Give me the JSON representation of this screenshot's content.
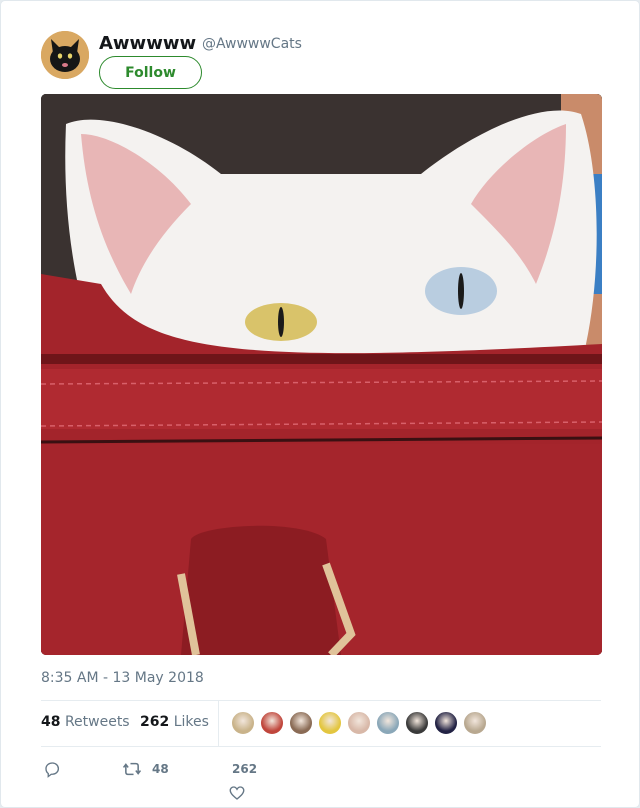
{
  "author": {
    "display_name": "Awwwww",
    "handle": "@AwwwwCats",
    "avatar_icon": "black-cat-avatar"
  },
  "follow_button": {
    "label": "Follow",
    "color": "#2d8a2d"
  },
  "media": {
    "description_icon": "white-cat-in-red-bag-photo"
  },
  "timestamp": "8:35 AM - 13 May 2018",
  "stats": {
    "retweets_count": "48",
    "retweets_label": "Retweets",
    "likes_count": "262",
    "likes_label": "Likes"
  },
  "likers": [
    {
      "color": "#c9b38a"
    },
    {
      "color": "#c0463c"
    },
    {
      "color": "#8a6b55"
    },
    {
      "color": "#e3c640"
    },
    {
      "color": "#d8b8a8"
    },
    {
      "color": "#8aa7b8"
    },
    {
      "color": "#3a3a3a"
    },
    {
      "color": "#222244"
    },
    {
      "color": "#b8a890"
    }
  ],
  "actions": {
    "reply_icon": "reply-icon",
    "retweet_icon": "retweet-icon",
    "retweet_count": "48",
    "like_icon": "heart-icon",
    "like_count": "262"
  }
}
